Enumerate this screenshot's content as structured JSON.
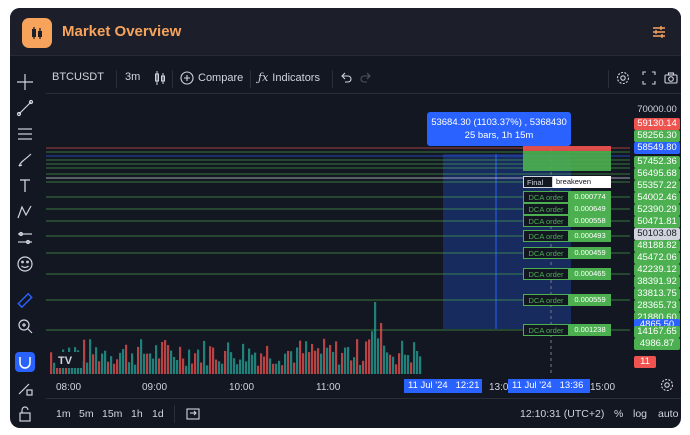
{
  "window": {
    "title": "Market Overview"
  },
  "toolbar": {
    "symbol": "BTCUSDT",
    "interval": "3m",
    "compare_label": "Compare",
    "indicators_label": "Indicators"
  },
  "tooltip": {
    "line1": "53684.30 (1103.37%) , 5368430",
    "line2": "25 bars, 1h 15m"
  },
  "price_labels": [
    {
      "text": "70000.00",
      "kind": "plain"
    },
    {
      "text": "59130.14",
      "kind": "red"
    },
    {
      "text": "58256.30",
      "kind": "green"
    },
    {
      "text": "58549.80",
      "kind": "blue"
    },
    {
      "text": "57452.36",
      "kind": "green"
    },
    {
      "text": "56495.68",
      "kind": "green"
    },
    {
      "text": "55357.22",
      "kind": "green"
    },
    {
      "text": "54002.46",
      "kind": "green"
    },
    {
      "text": "52390.29",
      "kind": "green"
    },
    {
      "text": "50471.81",
      "kind": "green"
    },
    {
      "text": "50103.08",
      "kind": "white"
    },
    {
      "text": "48188.82",
      "kind": "green"
    },
    {
      "text": "45472.06",
      "kind": "green"
    },
    {
      "text": "42239.12",
      "kind": "green"
    },
    {
      "text": "38391.92",
      "kind": "green"
    },
    {
      "text": "33813.75",
      "kind": "green"
    },
    {
      "text": "28365.73",
      "kind": "green"
    },
    {
      "text": "21880.60",
      "kind": "green"
    },
    {
      "text": "4865.50",
      "kind": "blue"
    },
    {
      "text": "14167.65",
      "kind": "green"
    },
    {
      "text": "4986.87",
      "kind": "green"
    },
    {
      "text": "11",
      "kind": "red"
    }
  ],
  "dca_orders": [
    {
      "label": "DCA order",
      "value": "0.000774"
    },
    {
      "label": "DCA order",
      "value": "0.000649"
    },
    {
      "label": "DCA order",
      "value": "0.000558"
    },
    {
      "label": "DCA order",
      "value": "0.000493"
    },
    {
      "label": "DCA order",
      "value": "0.000459"
    },
    {
      "label": "DCA order",
      "value": "0.000465"
    },
    {
      "label": "DCA order",
      "value": "0.000559"
    },
    {
      "label": "DCA order",
      "value": "0.001238"
    }
  ],
  "final_tag": {
    "left": "Final",
    "right": "breakeven"
  },
  "time_axis": {
    "ticks": [
      "08:00",
      "09:00",
      "10:00",
      "11:00",
      "13:00",
      "15:00"
    ],
    "marker_left": "11 Jul '24   12:21",
    "marker_right": "11 Jul '24   13:36"
  },
  "bottom": {
    "ranges": [
      "1m",
      "5m",
      "15m",
      "1h",
      "1d"
    ],
    "clock": "12:10:31 (UTC+2)",
    "percent": "%",
    "log": "log",
    "auto": "auto"
  },
  "colors": {
    "background": "#131722",
    "accent": "#f7a35c",
    "blue": "#2962ff",
    "green": "#4caf50",
    "red": "#ef5350"
  }
}
